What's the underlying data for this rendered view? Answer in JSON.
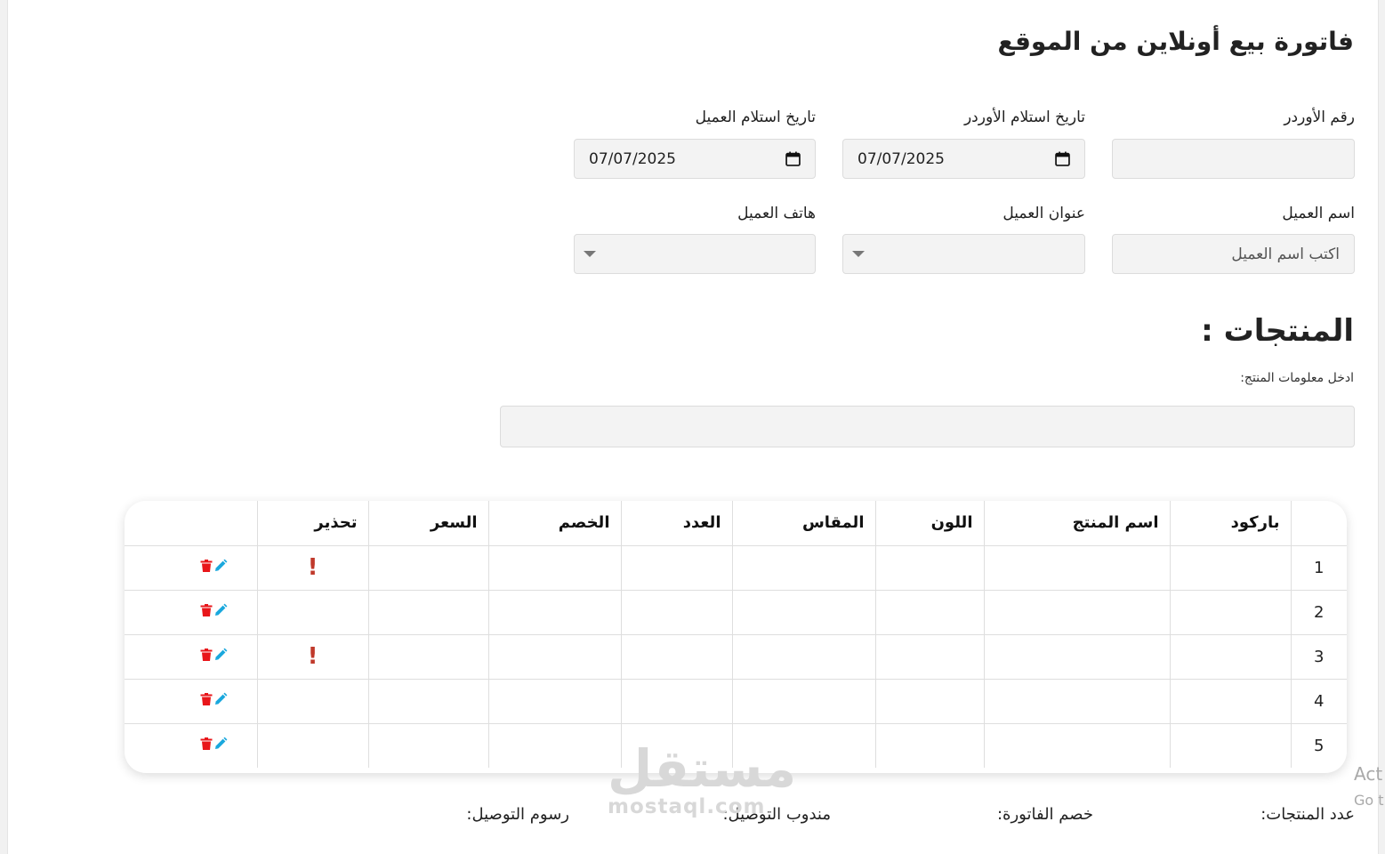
{
  "page": {
    "title": "فاتورة بيع أونلاين من الموقع"
  },
  "form": {
    "order_number": {
      "label": "رقم الأوردر",
      "value": ""
    },
    "order_receive_date": {
      "label": "تاريخ استلام الأوردر",
      "value": "07/07/2025"
    },
    "customer_receive_date": {
      "label": "تاريخ استلام العميل",
      "value": "07/07/2025"
    },
    "customer_name": {
      "label": "اسم العميل",
      "placeholder": "اكتب اسم العميل"
    },
    "customer_address": {
      "label": "عنوان العميل",
      "value": ""
    },
    "customer_phone": {
      "label": "هاتف العميل",
      "value": ""
    }
  },
  "products": {
    "title": "المنتجات :",
    "hint": "ادخل معلومات المنتج:",
    "input_value": ""
  },
  "table": {
    "headers": [
      "باركود",
      "اسم المنتج",
      "اللون",
      "المقاس",
      "العدد",
      "الخصم",
      "السعر",
      "تحذير"
    ],
    "rows": [
      {
        "num": "1",
        "warning": "!"
      },
      {
        "num": "2",
        "warning": ""
      },
      {
        "num": "3",
        "warning": "!"
      },
      {
        "num": "4",
        "warning": ""
      },
      {
        "num": "5",
        "warning": ""
      }
    ],
    "colors": {
      "edit": "#1aa8dd",
      "delete": "#e8161a",
      "warning": "#c0392b"
    }
  },
  "footer": {
    "products_count": "عدد المنتجات:",
    "invoice_discount": "خصم الفاتورة:",
    "delivery_agent": "مندوب التوصيل:",
    "delivery_fee": "رسوم التوصيل:"
  },
  "watermark": {
    "arabic": "مستقل",
    "latin": "mostaql.com"
  },
  "os_overlay": {
    "line1": "Act",
    "line2": "Go t"
  }
}
